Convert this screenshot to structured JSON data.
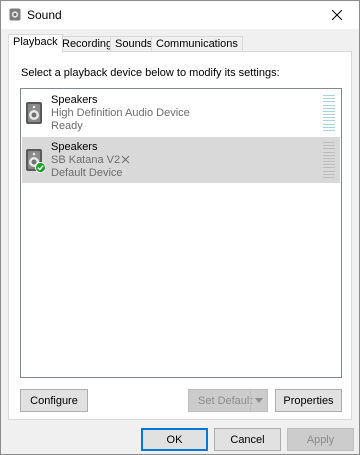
{
  "window": {
    "title": "Sound"
  },
  "tabs": [
    {
      "label": "Playback",
      "active": true
    },
    {
      "label": "Recording",
      "active": false
    },
    {
      "label": "Sounds",
      "active": false
    },
    {
      "label": "Communications",
      "active": false
    }
  ],
  "playback": {
    "instruction": "Select a playback device below to modify its settings:",
    "devices": [
      {
        "name": "Speakers",
        "description": "High Definition Audio Device",
        "status": "Ready",
        "selected": false,
        "is_default": false
      },
      {
        "name": "Speakers",
        "description": "SB Katana V2",
        "status": "Default Device",
        "selected": true,
        "is_default": true
      }
    ],
    "configure_label": "Configure",
    "set_default_label": "Set Default",
    "properties_label": "Properties"
  },
  "footer": {
    "ok_label": "OK",
    "cancel_label": "Cancel",
    "apply_label": "Apply"
  },
  "colors": {
    "selection": "#d9d9d9",
    "default_check": "#1aa526",
    "meter_idle": "#a8d4e0",
    "focus_border": "#0078d7"
  }
}
